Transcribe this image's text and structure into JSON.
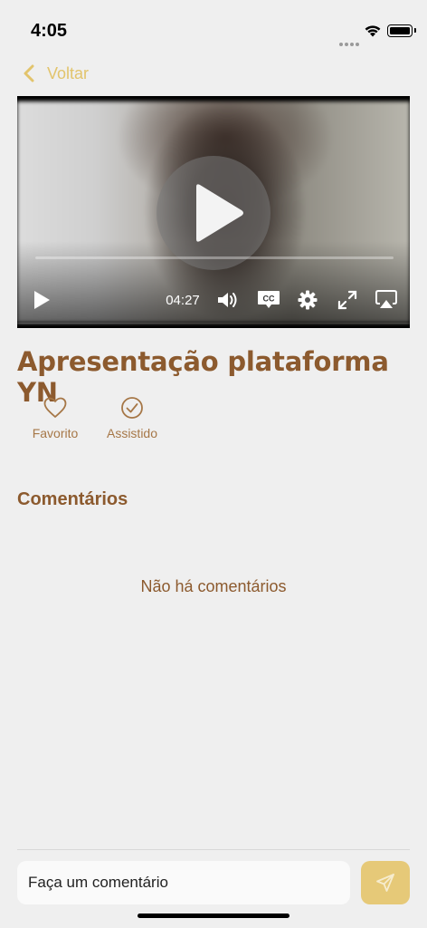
{
  "status_bar": {
    "time": "4:05"
  },
  "header": {
    "back_label": "Voltar"
  },
  "video": {
    "duration": "04:27"
  },
  "content": {
    "title": "Apresentação plataforma YN"
  },
  "actions": [
    {
      "label": "Favorito",
      "icon": "heart-icon"
    },
    {
      "label": "Assistido",
      "icon": "check-circle-icon"
    }
  ],
  "comments": {
    "section_title": "Comentários",
    "empty_message": "Não há comentários"
  },
  "composer": {
    "placeholder": "Faça um comentário"
  },
  "colors": {
    "accent": "#e2c46c",
    "title_brown": "#8c5a2e",
    "label_brown": "#a67747",
    "send_button": "#e6c978"
  }
}
